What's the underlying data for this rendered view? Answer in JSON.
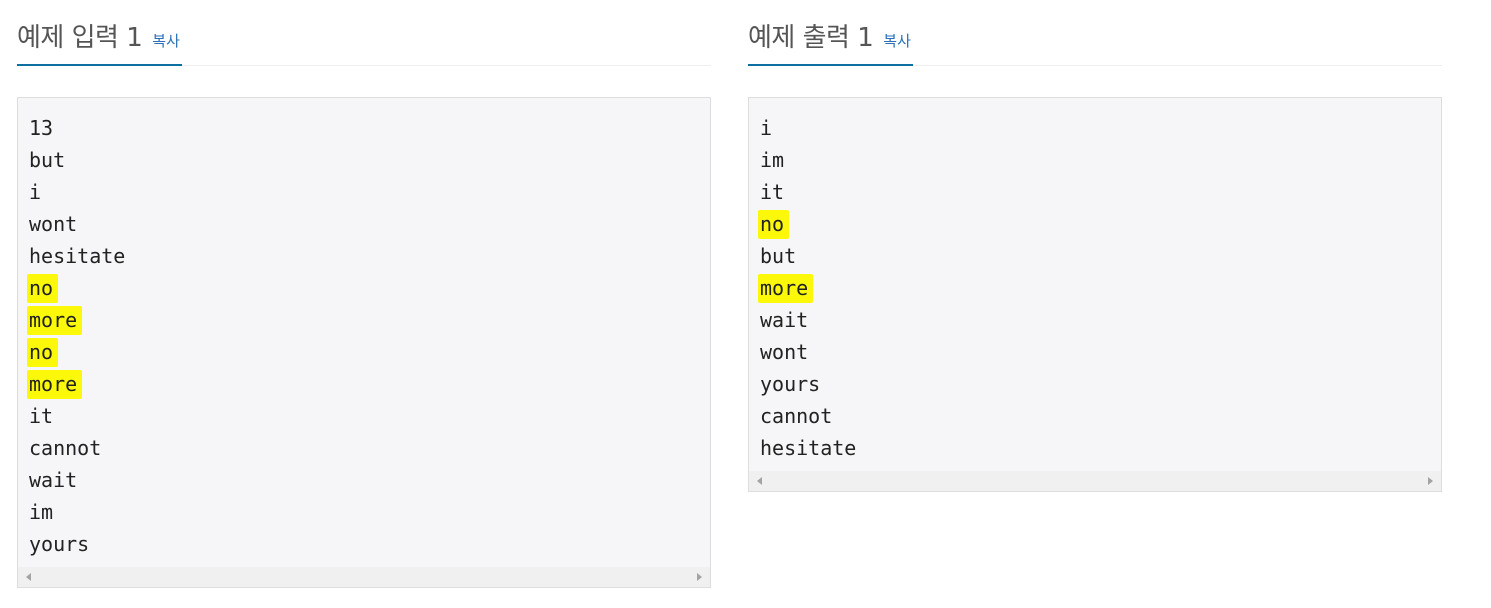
{
  "input_panel": {
    "title": "예제 입력 1",
    "copy_label": "복사",
    "lines": [
      {
        "text": "13",
        "highlighted": false
      },
      {
        "text": "but",
        "highlighted": false
      },
      {
        "text": "i",
        "highlighted": false
      },
      {
        "text": "wont",
        "highlighted": false
      },
      {
        "text": "hesitate",
        "highlighted": false
      },
      {
        "text": "no",
        "highlighted": true
      },
      {
        "text": "more",
        "highlighted": true
      },
      {
        "text": "no",
        "highlighted": true
      },
      {
        "text": "more",
        "highlighted": true
      },
      {
        "text": "it",
        "highlighted": false
      },
      {
        "text": "cannot",
        "highlighted": false
      },
      {
        "text": "wait",
        "highlighted": false
      },
      {
        "text": "im",
        "highlighted": false
      },
      {
        "text": "yours",
        "highlighted": false
      }
    ]
  },
  "output_panel": {
    "title": "예제 출력 1",
    "copy_label": "복사",
    "lines": [
      {
        "text": "i",
        "highlighted": false
      },
      {
        "text": "im",
        "highlighted": false
      },
      {
        "text": "it",
        "highlighted": false
      },
      {
        "text": "no",
        "highlighted": true
      },
      {
        "text": "but",
        "highlighted": false
      },
      {
        "text": "more",
        "highlighted": true
      },
      {
        "text": "wait",
        "highlighted": false
      },
      {
        "text": "wont",
        "highlighted": false
      },
      {
        "text": "yours",
        "highlighted": false
      },
      {
        "text": "cannot",
        "highlighted": false
      },
      {
        "text": "hesitate",
        "highlighted": false
      }
    ]
  },
  "colors": {
    "accent": "#0d6ea0",
    "link": "#2a70b8",
    "highlight": "#fbf80a",
    "sample_background": "#f6f6f8"
  },
  "icons": {
    "scroll_left": "scroll-left-arrow-icon",
    "scroll_right": "scroll-right-arrow-icon"
  }
}
